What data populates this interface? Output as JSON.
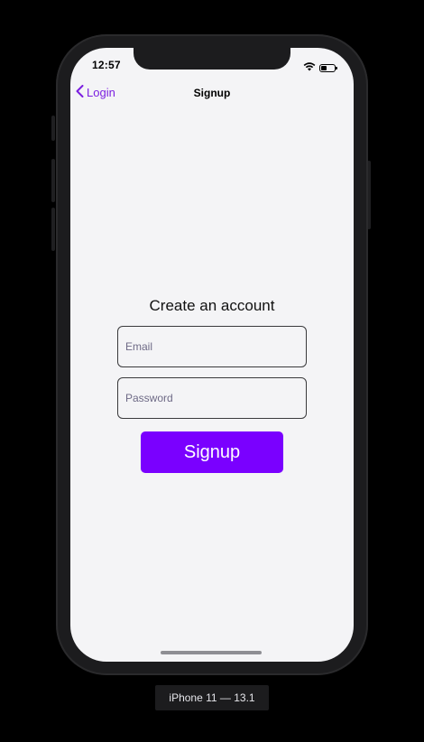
{
  "status_bar": {
    "time": "12:57"
  },
  "nav": {
    "back_label": "Login",
    "title": "Signup"
  },
  "form": {
    "heading": "Create an account",
    "email_placeholder": "Email",
    "password_placeholder": "Password",
    "submit_label": "Signup"
  },
  "device": {
    "label": "iPhone 11 — 13.1"
  },
  "colors": {
    "accent": "#7a00ff",
    "back_link": "#7b1fe0",
    "screen_background": "#f4f4f6"
  },
  "icons": {
    "back": "chevron-left-icon",
    "wifi": "wifi-icon",
    "battery": "battery-icon"
  }
}
